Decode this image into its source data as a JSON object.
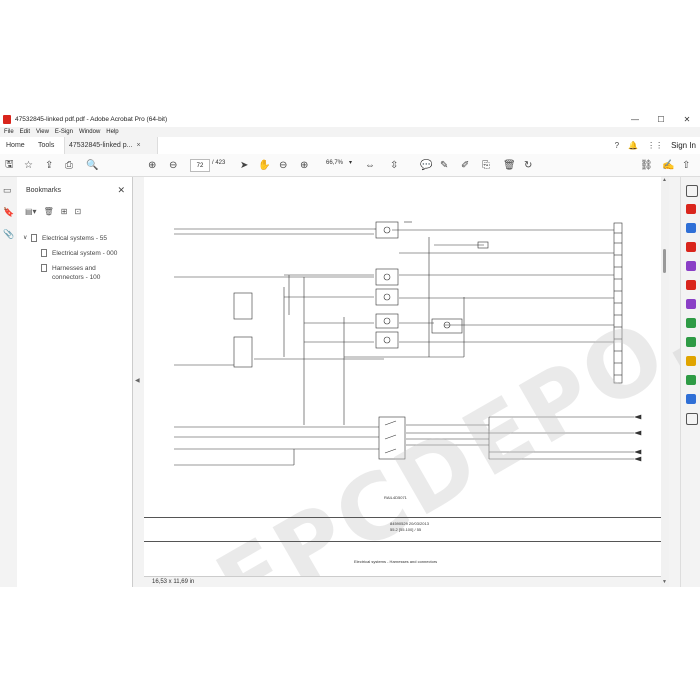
{
  "window": {
    "title": "47532845-linked pdf.pdf - Adobe Acrobat Pro (64-bit)",
    "controls": [
      "—",
      "☐",
      "✕"
    ]
  },
  "menu": [
    "File",
    "Edit",
    "View",
    "E-Sign",
    "Window",
    "Help"
  ],
  "tabs": {
    "home": "Home",
    "tools": "Tools",
    "document": "47532845-linked p...",
    "close": "×"
  },
  "header_right": {
    "signin": "Sign In"
  },
  "toolbar": {
    "current_page": "72",
    "page_count": "/ 423",
    "zoom": "66,7%"
  },
  "bookmarks": {
    "title": "Bookmarks",
    "items": [
      {
        "label": "Electrical systems - 55"
      },
      {
        "label": "Electrical system - 000"
      },
      {
        "label": "Harnesses and"
      },
      {
        "label": "connectors - 100"
      }
    ]
  },
  "document": {
    "footer_code": "84590529 20/03/2013",
    "footer_ref": "55.2 [55.100] / 55",
    "footer_title": "Electrical systems - Harnesses and connectors",
    "small_caption": "RAIL4D5071",
    "watermark": "EPCDEPO.COM"
  },
  "status": {
    "page_size": "16,53 x 11,69 in"
  },
  "colors": {
    "accent": "#d9251c",
    "rail_red": "#d9251c",
    "rail_blue": "#2f6fd6",
    "rail_green": "#2e9b45",
    "rail_purple": "#8a3fc6",
    "rail_yellow": "#e0a400"
  }
}
